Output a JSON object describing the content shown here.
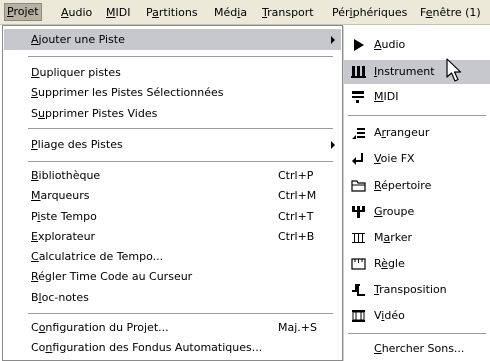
{
  "menubar": {
    "items": [
      {
        "pre": "",
        "u": "P",
        "post": "rojet"
      },
      {
        "pre": "",
        "u": "A",
        "post": "udio"
      },
      {
        "pre": "",
        "u": "M",
        "post": "IDI"
      },
      {
        "pre": "P",
        "u": "a",
        "post": "rtitions"
      },
      {
        "pre": "Méd",
        "u": "i",
        "post": "a"
      },
      {
        "pre": "",
        "u": "T",
        "post": "ransport"
      },
      {
        "pre": "Pér",
        "u": "i",
        "post": "phériques"
      },
      {
        "pre": "F",
        "u": "e",
        "post": "nêtre (1)"
      }
    ]
  },
  "menu": {
    "items": [
      {
        "pre": "",
        "u": "A",
        "post": "jouter une Piste",
        "shortcut": ""
      },
      {
        "pre": "",
        "u": "D",
        "post": "upliquer pistes",
        "shortcut": ""
      },
      {
        "pre": "",
        "u": "S",
        "post": "upprimer les Pistes Sélectionnées",
        "shortcut": ""
      },
      {
        "pre": "S",
        "u": "u",
        "post": "pprimer Pistes Vides",
        "shortcut": ""
      },
      {
        "pre": "",
        "u": "P",
        "post": "liage des Pistes",
        "shortcut": ""
      },
      {
        "pre": "",
        "u": "B",
        "post": "ibliothèque",
        "shortcut": "Ctrl+P"
      },
      {
        "pre": "",
        "u": "M",
        "post": "arqueurs",
        "shortcut": "Ctrl+M"
      },
      {
        "pre": "P",
        "u": "i",
        "post": "ste Tempo",
        "shortcut": "Ctrl+T"
      },
      {
        "pre": "",
        "u": "E",
        "post": "xplorateur",
        "shortcut": "Ctrl+B"
      },
      {
        "pre": "",
        "u": "C",
        "post": "alculatrice de Tempo...",
        "shortcut": ""
      },
      {
        "pre": "",
        "u": "R",
        "post": "égler Time Code au Curseur",
        "shortcut": ""
      },
      {
        "pre": "B",
        "u": "l",
        "post": "oc-notes",
        "shortcut": ""
      },
      {
        "pre": "C",
        "u": "o",
        "post": "nfiguration du Projet...",
        "shortcut": "Maj.+S"
      },
      {
        "pre": "Co",
        "u": "n",
        "post": "figuration des Fondus Automatiques...",
        "shortcut": ""
      }
    ]
  },
  "submenu": {
    "items": [
      {
        "pre": "",
        "u": "A",
        "post": "udio",
        "icon": "play-arrow-icon"
      },
      {
        "pre": "",
        "u": "I",
        "post": "nstrument",
        "icon": "instrument-keys-icon"
      },
      {
        "pre": "",
        "u": "M",
        "post": "IDI",
        "icon": "midi-icon"
      },
      {
        "pre": "A",
        "u": "r",
        "post": "rangeur",
        "icon": "arranger-icon"
      },
      {
        "pre": "",
        "u": "V",
        "post": "oie FX",
        "icon": "fx-return-icon"
      },
      {
        "pre": "",
        "u": "R",
        "post": "épertoire",
        "icon": "folder-icon"
      },
      {
        "pre": "",
        "u": "G",
        "post": "roupe",
        "icon": "group-icon"
      },
      {
        "pre": "M",
        "u": "a",
        "post": "rker",
        "icon": "marker-icon"
      },
      {
        "pre": "R",
        "u": "è",
        "post": "gle",
        "icon": "ruler-icon"
      },
      {
        "pre": "",
        "u": "T",
        "post": "ransposition",
        "icon": "transpose-icon"
      },
      {
        "pre": "V",
        "u": "i",
        "post": "déo",
        "icon": "video-icon"
      },
      {
        "pre": "",
        "u": "C",
        "post": "hercher Sons...",
        "icon": ""
      }
    ]
  },
  "colors": {
    "menubar_bg": "#ece9d8",
    "highlight": "#c7c8ce",
    "separator": "#9c9c9c"
  }
}
